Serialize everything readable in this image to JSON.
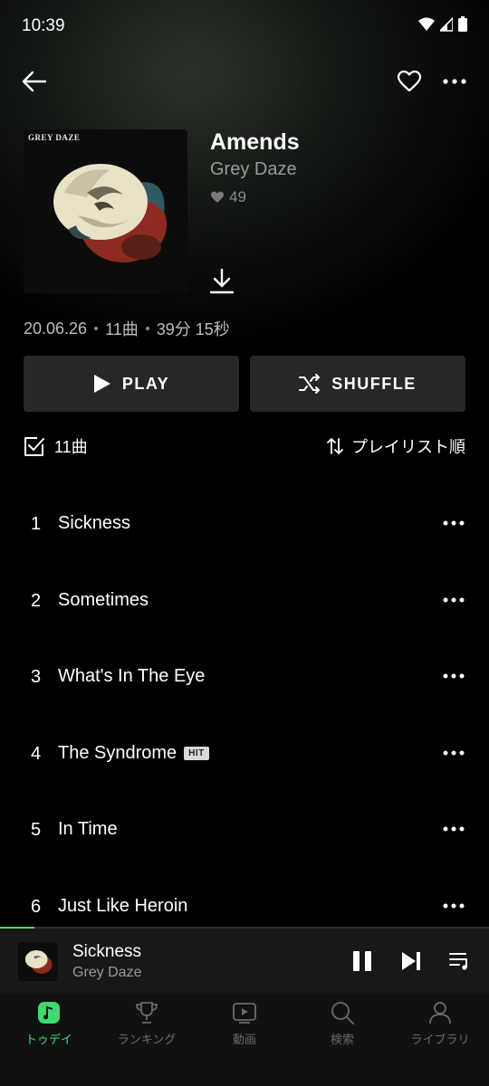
{
  "status": {
    "time": "10:39"
  },
  "album": {
    "cover_text": "GREY DAZE",
    "title": "Amends",
    "artist": "Grey Daze",
    "likes": "49",
    "date": "20.06.26",
    "track_count": "11曲",
    "duration": "39分 15秒"
  },
  "actions": {
    "play_label": "PLAY",
    "shuffle_label": "SHUFFLE"
  },
  "list_header": {
    "count": "11曲",
    "sort_label": "プレイリスト順"
  },
  "tracks": [
    {
      "num": "1",
      "title": "Sickness"
    },
    {
      "num": "2",
      "title": "Sometimes"
    },
    {
      "num": "3",
      "title": "What's In The Eye"
    },
    {
      "num": "4",
      "title": "The Syndrome",
      "badge": "HIT"
    },
    {
      "num": "5",
      "title": "In Time"
    },
    {
      "num": "6",
      "title": "Just Like Heroin"
    }
  ],
  "now_playing": {
    "title": "Sickness",
    "artist": "Grey Daze",
    "progress": 0.07
  },
  "tabs": [
    {
      "label": "トゥデイ",
      "icon": "music-note-icon",
      "active": true
    },
    {
      "label": "ランキング",
      "icon": "trophy-icon",
      "active": false
    },
    {
      "label": "動画",
      "icon": "video-icon",
      "active": false
    },
    {
      "label": "検索",
      "icon": "search-icon",
      "active": false
    },
    {
      "label": "ライブラリ",
      "icon": "person-icon",
      "active": false
    }
  ],
  "colors": {
    "accent": "#3ddc6f",
    "button_bg": "#272727",
    "background": "#000000"
  }
}
